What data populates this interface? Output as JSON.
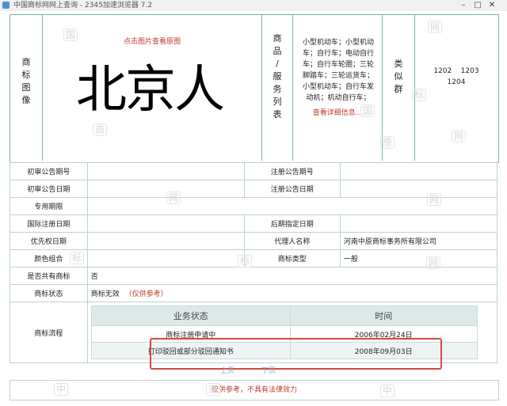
{
  "window": {
    "title": "中国商标网网上查询 - 2345加速浏览器 7.2",
    "buttons": {
      "minimize": "–",
      "maximize": "□",
      "close": "✕"
    }
  },
  "mark": {
    "image_label": "商标图像",
    "image_hint": "点击图片查看原图",
    "mark_text": "北京人",
    "goods_label": "商品/服务列表",
    "goods_text": "小型机动车；小型机动车；自行车；电动自行车；自行车轮圈；三轮脚踏车；三轮运货车；小型机动车；自行车发动机；机动自行车；",
    "goods_more": "查看详细信息...",
    "class_label": "类似群",
    "class_codes_line1": "1202    1203",
    "class_codes_line2": "1204"
  },
  "fields": {
    "prelim_pub_no": "初审公告期号",
    "reg_pub_no": "注册公告期号",
    "prelim_pub_date": "初审公告日期",
    "reg_pub_date": "注册公告日期",
    "exclusive_period": "专用期限",
    "intl_reg_date": "国际注册日期",
    "later_designation_date": "后期指定日期",
    "priority_date": "优先权日期",
    "agent_label": "代理人名称",
    "agent_value": "河南中原商标事务所有限公司",
    "color_combo": "颜色组合",
    "mark_type_label": "商标类型",
    "mark_type_value": "一般",
    "shared_label": "是否共有商标",
    "shared_value": "否",
    "status_label": "商标状态",
    "status_value": "商标无效",
    "status_note": "（仅供参考）",
    "process_label": "商标流程"
  },
  "process": {
    "header_status": "业务状态",
    "header_time": "时间",
    "rows": [
      {
        "status": "商标注册申请中",
        "time": "2006年02月24日"
      },
      {
        "status": "打印驳回或部分驳回通知书",
        "time": "2008年09月03日"
      }
    ]
  },
  "pager": {
    "prev": "上页",
    "next": "下页"
  },
  "footer": {
    "disclaimer": "仅供参考，不具有法律效力"
  },
  "watermarks": {
    "guo": "国",
    "shang": "商",
    "biao": "标",
    "wang": "网",
    "zhong": "中",
    "yuan": "原"
  }
}
